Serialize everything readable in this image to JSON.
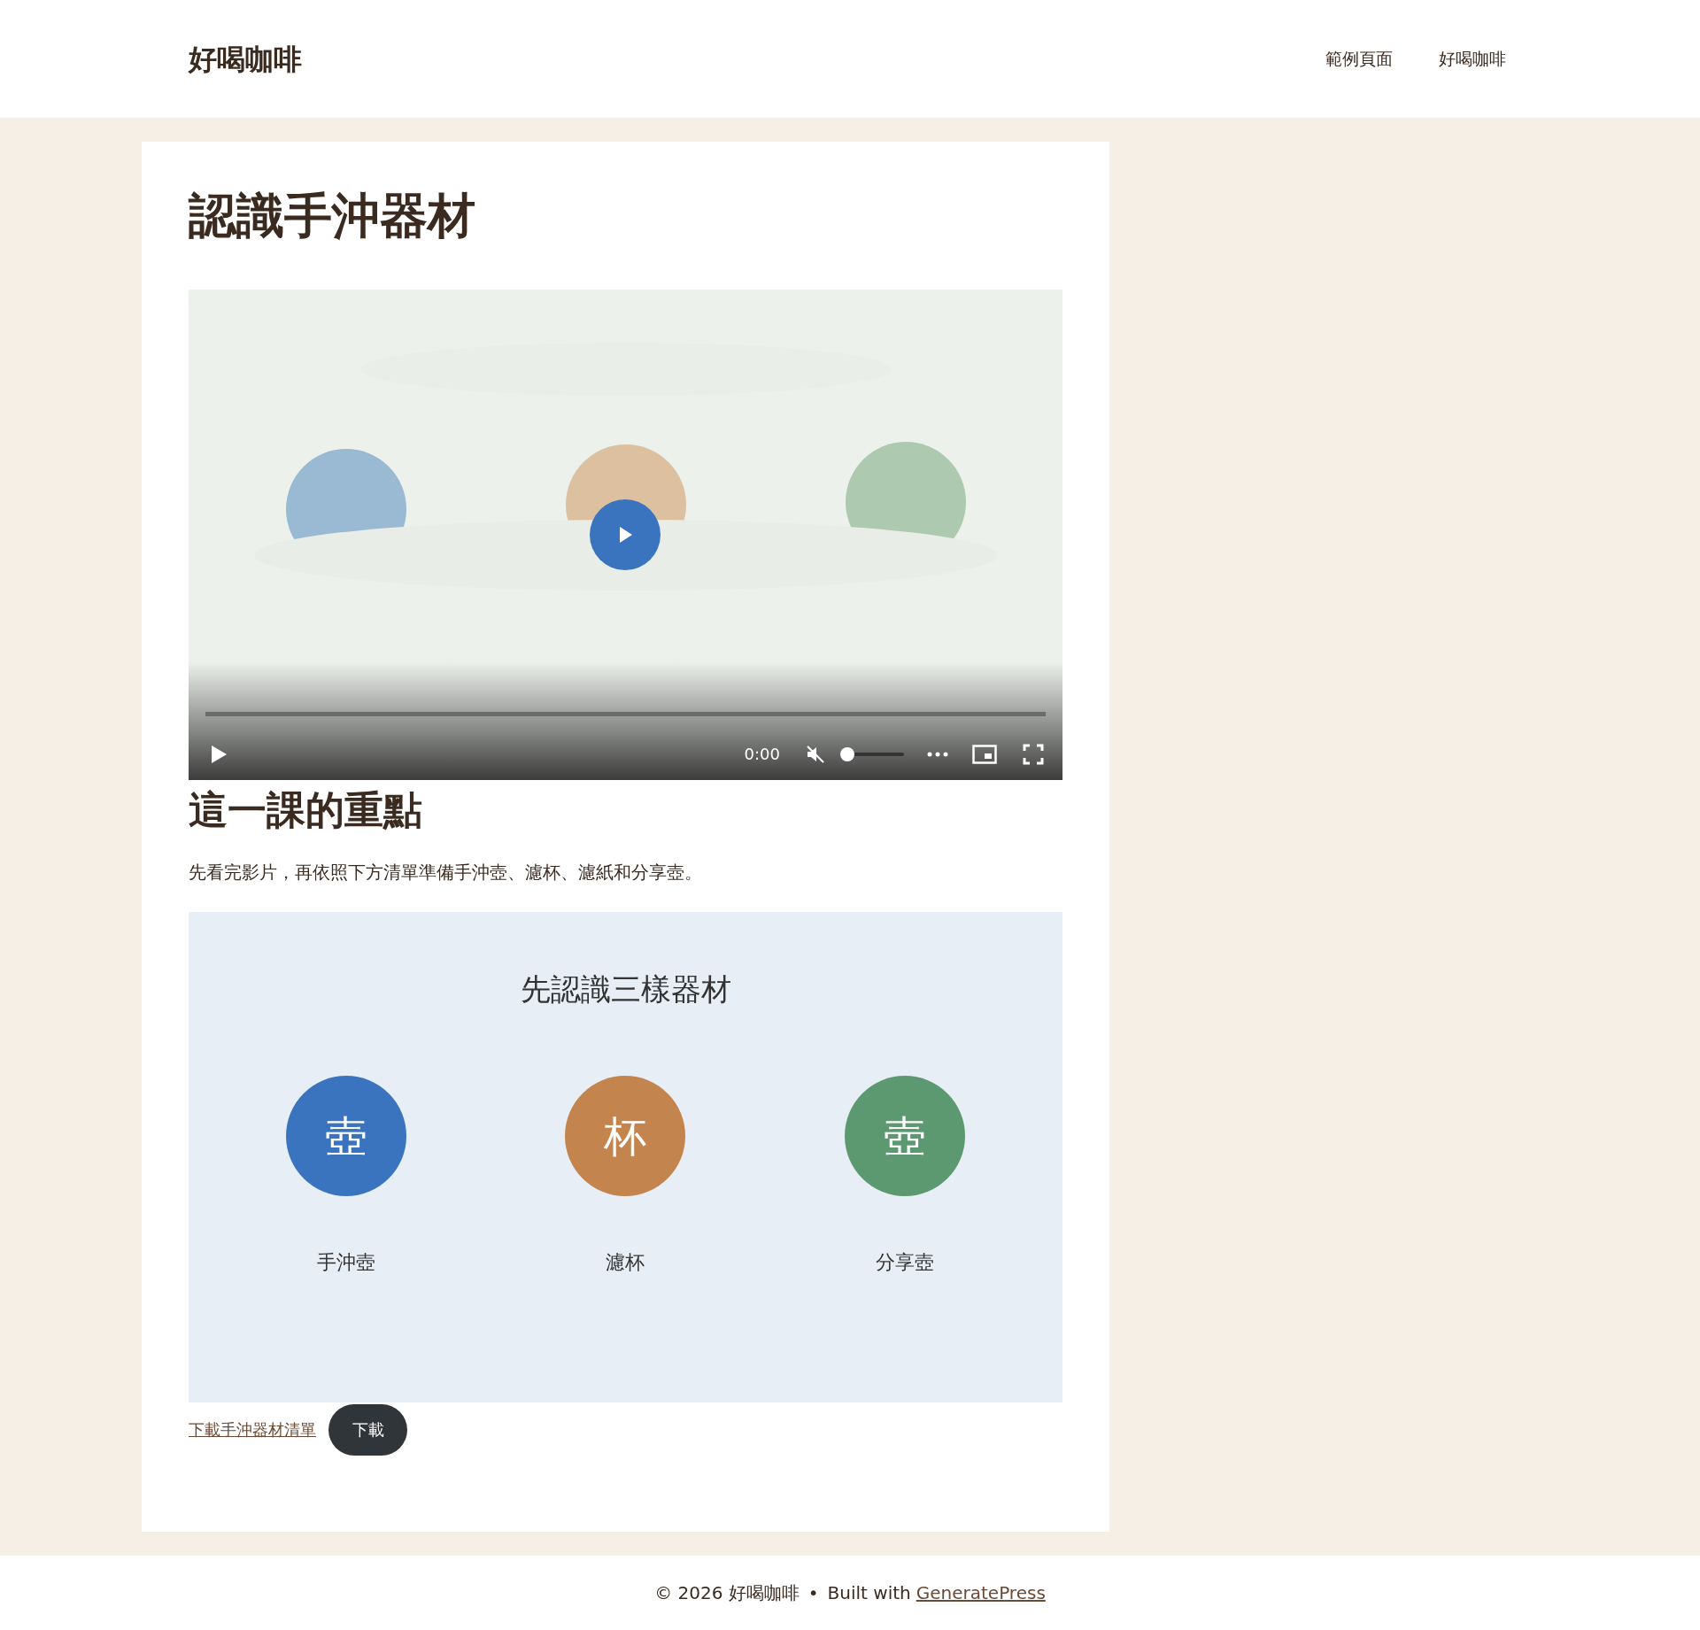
{
  "header": {
    "site_title": "好喝咖啡",
    "nav": [
      {
        "label": "範例頁面"
      },
      {
        "label": "好喝咖啡"
      }
    ]
  },
  "article": {
    "title": "認識手沖器材",
    "video": {
      "time": "0:00",
      "muted": true,
      "volume": {
        "level": 0
      }
    },
    "heading": "這一課的重點",
    "paragraph": "先看完影片，再依照下方清單準備手沖壺、濾杯、濾紙和分享壺。",
    "figure": {
      "title": "先認識三樣器材",
      "items": [
        {
          "glyph": "壺",
          "label": "手沖壺",
          "color": "#3a74bf"
        },
        {
          "glyph": "杯",
          "label": "濾杯",
          "color": "#c4844e"
        },
        {
          "glyph": "壺",
          "label": "分享壺",
          "color": "#5c9970"
        }
      ]
    },
    "download": {
      "link": "下載手沖器材清單",
      "button": "下載"
    }
  },
  "footer": {
    "copyright": "© 2026 好喝咖啡",
    "separator": "•",
    "built_with": "Built with",
    "link": "GeneratePress"
  }
}
